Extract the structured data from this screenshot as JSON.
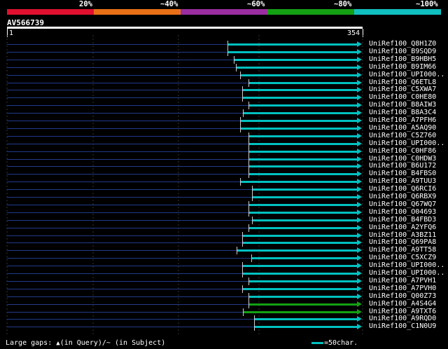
{
  "legend": {
    "labels": [
      "20%",
      "~40%",
      "~60%",
      "~80%",
      "~100%"
    ],
    "colors": [
      "#e0102e",
      "#e87016",
      "#9a2da0",
      "#13a013",
      "#10c0c0"
    ]
  },
  "query": {
    "title": "AV566739",
    "start": "1",
    "end": "354"
  },
  "colors": {
    "alignment": "#00c0c0",
    "alignment_green": "#13a013",
    "gap_line": "#223a8a"
  },
  "hits": [
    {
      "label": "UniRef100_Q8H1Z0",
      "color": "alignment"
    },
    {
      "label": "UniRef100_B9SQD9",
      "color": "alignment"
    },
    {
      "label": "UniRef100_B9HBH5",
      "color": "alignment"
    },
    {
      "label": "UniRef100_B9IM66",
      "color": "alignment"
    },
    {
      "label": "UniRef100_UPI000..",
      "color": "alignment"
    },
    {
      "label": "UniRef100_Q6ETL8",
      "color": "alignment"
    },
    {
      "label": "UniRef100_C5XWA7",
      "color": "alignment"
    },
    {
      "label": "UniRef100_C0HE80",
      "color": "alignment"
    },
    {
      "label": "UniRef100_B8AIW3",
      "color": "alignment"
    },
    {
      "label": "UniRef100_B8A3C4",
      "color": "alignment"
    },
    {
      "label": "UniRef100_A7PFH6",
      "color": "alignment"
    },
    {
      "label": "UniRef100_A5AQ90",
      "color": "alignment"
    },
    {
      "label": "UniRef100_C5Z760",
      "color": "alignment"
    },
    {
      "label": "UniRef100_UPI000..",
      "color": "alignment"
    },
    {
      "label": "UniRef100_C0HF86",
      "color": "alignment"
    },
    {
      "label": "UniRef100_C0HDW3",
      "color": "alignment"
    },
    {
      "label": "UniRef100_B6U172",
      "color": "alignment"
    },
    {
      "label": "UniRef100_B4FBS0",
      "color": "alignment"
    },
    {
      "label": "UniRef100_A9TUU3",
      "color": "alignment"
    },
    {
      "label": "UniRef100_Q6RCI6",
      "color": "alignment"
    },
    {
      "label": "UniRef100_Q6RBX9",
      "color": "alignment"
    },
    {
      "label": "UniRef100_Q67WQ7",
      "color": "alignment"
    },
    {
      "label": "UniRef100_O04693",
      "color": "alignment"
    },
    {
      "label": "UniRef100_B4FBD3",
      "color": "alignment"
    },
    {
      "label": "UniRef100_A2YFQ6",
      "color": "alignment"
    },
    {
      "label": "UniRef100_A3BZ11",
      "color": "alignment"
    },
    {
      "label": "UniRef100_Q69PA8",
      "color": "alignment"
    },
    {
      "label": "UniRef100_A9TT58",
      "color": "alignment"
    },
    {
      "label": "UniRef100_C5XCZ9",
      "color": "alignment"
    },
    {
      "label": "UniRef100_UPI000..",
      "color": "alignment"
    },
    {
      "label": "UniRef100_UPI000..",
      "color": "alignment"
    },
    {
      "label": "UniRef100_A7PVH1",
      "color": "alignment"
    },
    {
      "label": "UniRef100_A7PVH0",
      "color": "alignment"
    },
    {
      "label": "UniRef100_Q00Z73",
      "color": "alignment"
    },
    {
      "label": "UniRef100_A4S4G4",
      "color": "alignment_green"
    },
    {
      "label": "UniRef100_A9TXT6",
      "color": "alignment_green"
    },
    {
      "label": "UniRef100_A9RQD0",
      "color": "alignment"
    },
    {
      "label": "UniRef100_C1N0U9",
      "color": "alignment"
    }
  ],
  "footer": {
    "large_gaps": "Large gaps:",
    "in_query": "(in Query)/",
    "in_subject": "(in Subject)",
    "query_gap_symbol": "▲",
    "subject_gap_symbol": "~",
    "scale": "=50char."
  }
}
